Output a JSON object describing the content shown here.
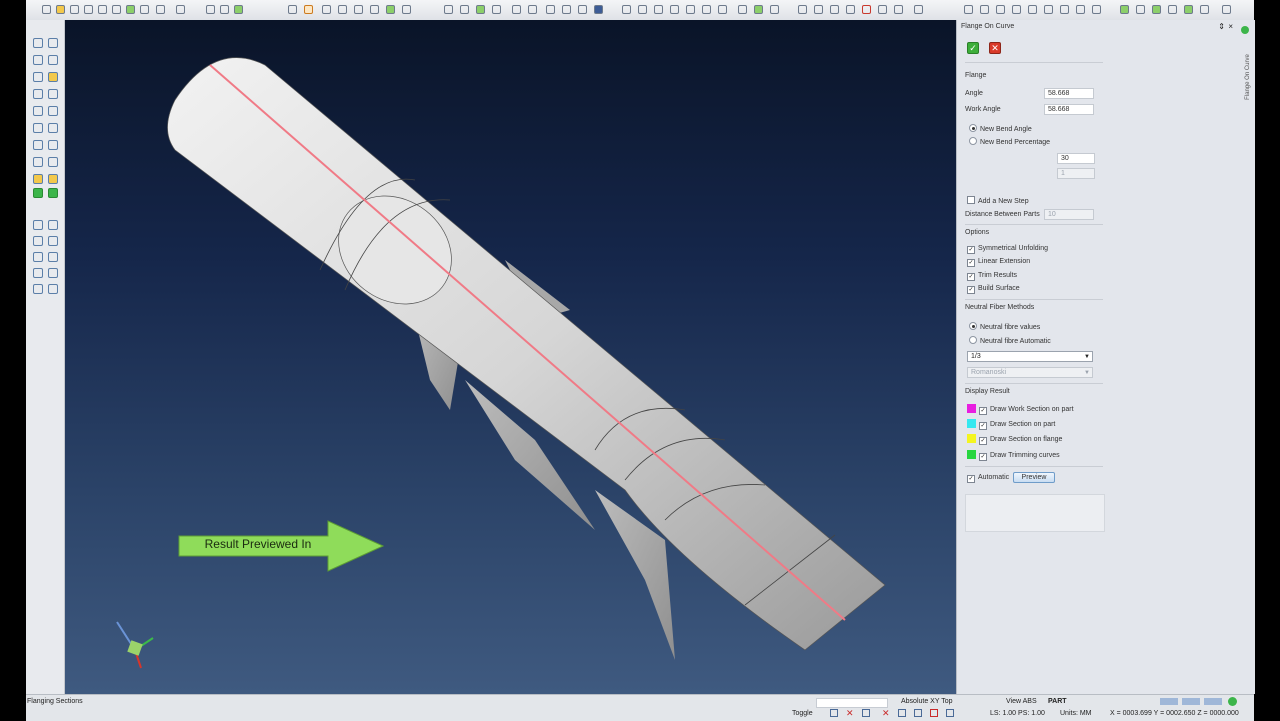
{
  "panel": {
    "title": "Flange On Curve",
    "side_tab": "Flange On Curve",
    "section_flange": "Flange",
    "angle_label": "Angle",
    "angle_value": "58.668",
    "work_angle_label": "Work Angle",
    "work_angle_value": "58.668",
    "radio_new_bend_angle": "New Bend Angle",
    "radio_new_bend_percentage": "New Bend Percentage",
    "percentage_value": "30",
    "secondary_value": "1",
    "add_step_label": "Add a New Step",
    "distance_label": "Distance Between Parts",
    "distance_value": "10",
    "section_options": "Options",
    "opt_symmetrical": "Symmetrical Unfolding",
    "opt_linear": "Linear Extension",
    "opt_trim": "Trim Results",
    "opt_build": "Build Surface",
    "section_neutral": "Neutral Fiber Methods",
    "neutral_values": "Neutral fibre values",
    "neutral_auto": "Neutral fibre Automatic",
    "neutral_select": "1/3",
    "neutral_select2": "Romanoski",
    "section_display": "Display Result",
    "disp_work_section": "Draw Work Section on part",
    "disp_section_part": "Draw Section on part",
    "disp_section_flange": "Draw Section on flange",
    "disp_trimming": "Draw Trimming curves",
    "automatic_label": "Automatic",
    "preview_label": "Preview"
  },
  "colors": {
    "work_section": "#e81ee0",
    "section_part": "#35e8f0",
    "section_flange": "#f4f520",
    "trimming": "#28d640",
    "callout": "#8fdc5a"
  },
  "viewport": {
    "callout_text": "Result Previewed In"
  },
  "statusbar": {
    "left_label": "Flanging Sections",
    "view_mode": "Absolute XY Top",
    "view_abs": "View ABS",
    "part": "PART",
    "toggle": "Toggle",
    "ls_ps": "LS: 1.00 PS: 1.00",
    "units": "Units: MM",
    "coords": "X = 0003.699 Y = 0002.650 Z = 0000.000"
  }
}
